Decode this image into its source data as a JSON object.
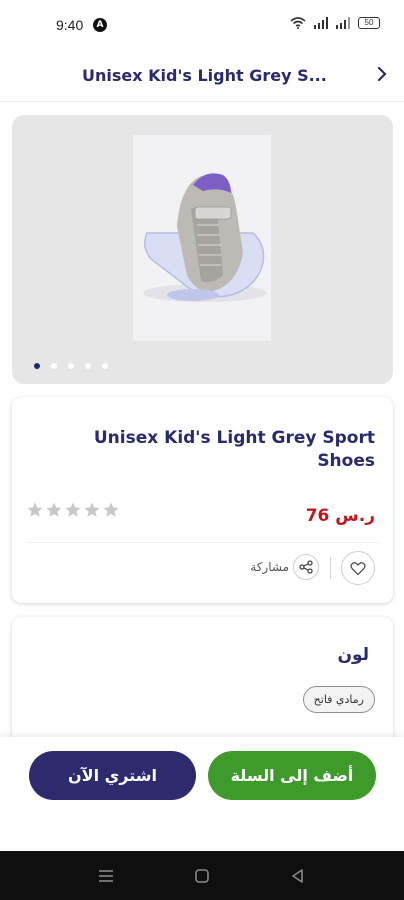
{
  "status_bar": {
    "time": "9:40",
    "app_icon_glyph": "A",
    "battery": "50"
  },
  "header": {
    "title": "Unisex Kid's Light Grey S...",
    "back_icon": "chevron-right-icon"
  },
  "gallery": {
    "image_alt": "Unisex Kid's Light Grey Sport Shoes",
    "dot_count": 5,
    "active_dot": 0
  },
  "product": {
    "title": "Unisex Kid's Light Grey Sport Shoes",
    "price": "76 ر.س",
    "rating": 0,
    "rating_max": 5,
    "share_label": "مشاركة",
    "wishlist_icon": "heart-icon",
    "share_icon": "share-icon"
  },
  "color_section": {
    "title": "لون",
    "selected_option": "رمادي فاتح"
  },
  "actions": {
    "buy_now": "اشتري الآن",
    "add_to_cart": "أضف إلى السلة"
  },
  "colors": {
    "brand_navy": "#2d2a6e",
    "title_navy": "#2a2a6e",
    "cart_green": "#3f9a2c",
    "price_red": "#c3161c",
    "star_grey": "#c8c8c8"
  }
}
